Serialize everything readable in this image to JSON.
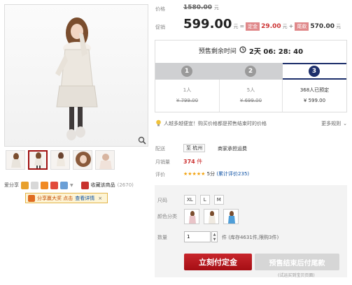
{
  "price": {
    "price_label": "价格",
    "original_price": "1580.00",
    "original_unit": "元",
    "promo_label": "促销",
    "promo_price": "599.00",
    "promo_unit": "元",
    "equals": "=",
    "deposit_tag": "定金",
    "deposit_value": "29.00",
    "deposit_unit": "元",
    "plus": "+",
    "balance_tag": "尾款",
    "balance_value": "570.00",
    "balance_unit": "元"
  },
  "countdown": {
    "label": "预售剩余时间",
    "value": "2天 06: 28: 40"
  },
  "steps": [
    {
      "num": "1",
      "people": "1人",
      "price": "¥ 799.00"
    },
    {
      "num": "2",
      "people": "5人",
      "price": "¥ 699.00"
    },
    {
      "num": "3",
      "people": "368人已预定",
      "price": "¥ 599.00"
    }
  ],
  "notice": {
    "text": "人越多越便宜！购买价格都是预售结束时的价格",
    "more": "更多规则"
  },
  "delivery": {
    "label": "配送",
    "from": "至 杭州",
    "fee": "商家承担运费"
  },
  "sales": {
    "label": "月销量",
    "value": "374",
    "unit": "件"
  },
  "rating": {
    "label": "评价",
    "stars": "★★★★★",
    "score": "5分",
    "count": "(累计评价235)"
  },
  "size": {
    "label": "尺码",
    "options": [
      "XL",
      "L",
      "M"
    ]
  },
  "color": {
    "label": "颜色分类"
  },
  "qty": {
    "label": "数量",
    "value": "1",
    "unit": "件",
    "stock": "(库存4631件,限购3件)"
  },
  "buttons": {
    "pay_deposit": "立刻付定金",
    "pay_balance": "预售结束后付尾款",
    "footnote": "(试运买到宝贝页面)"
  },
  "share": {
    "label": "爱分享",
    "favorite": "收藏该商品",
    "favorite_count": "(2670)"
  },
  "tip": {
    "text": "分享赢大奖 点击",
    "link": "查看详情",
    "close": "×"
  }
}
